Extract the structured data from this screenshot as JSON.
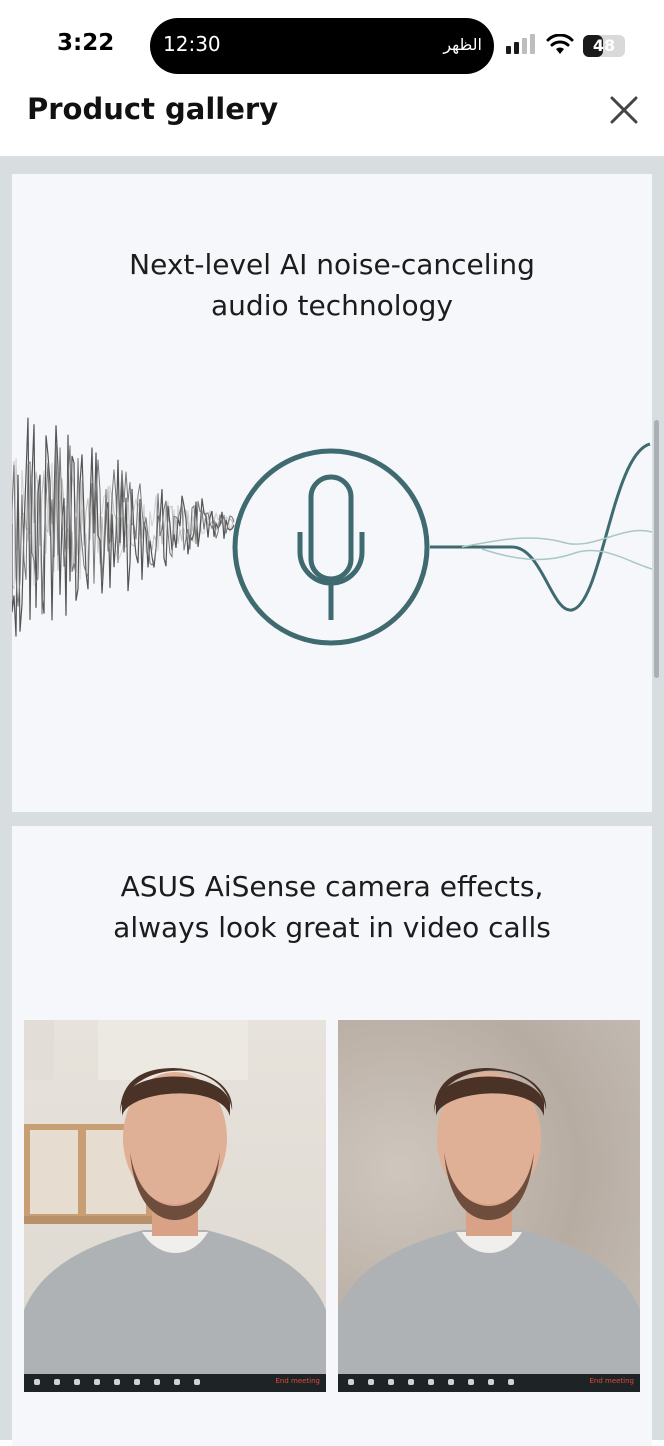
{
  "status_bar": {
    "time": "3:22",
    "island_time": "12:30",
    "island_label": "الظهر",
    "battery": "48",
    "battery_level": 0.48
  },
  "header": {
    "title": "Product gallery",
    "close_icon": "close-icon"
  },
  "gallery": {
    "panels": [
      {
        "heading_line1": "Next-level AI noise-canceling",
        "heading_line2": "audio technology",
        "icon": "microphone-icon",
        "accent_color": "#3f6a70"
      },
      {
        "heading_line1": "ASUS AiSense camera effects,",
        "heading_line2": "always look great in video calls",
        "photos": [
          {
            "name": "video-call-original-background",
            "end_label": "End meeting"
          },
          {
            "name": "video-call-blurred-background",
            "end_label": "End meeting"
          }
        ]
      }
    ]
  }
}
